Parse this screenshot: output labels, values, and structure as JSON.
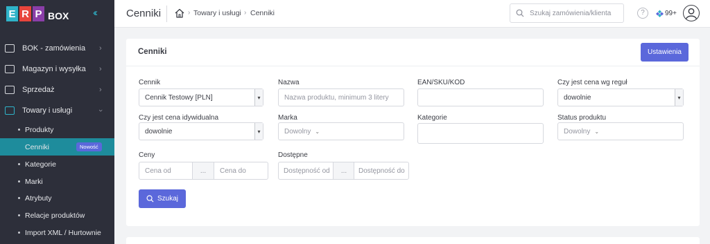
{
  "logo": {
    "letters": [
      "E",
      "R",
      "P"
    ],
    "colors": [
      "#2fb3c9",
      "#e8453c",
      "#8a3ea8"
    ],
    "suffix": "BOX"
  },
  "sidebar": {
    "items": [
      {
        "label": "BOK - zamówienia",
        "icon": "inbox-icon"
      },
      {
        "label": "Magazyn i wysyłka",
        "icon": "warehouse-icon"
      },
      {
        "label": "Sprzedaż",
        "icon": "cart-icon"
      },
      {
        "label": "Towary i usługi",
        "icon": "products-icon",
        "expanded": true
      }
    ],
    "subitems": [
      {
        "label": "Produkty"
      },
      {
        "label": "Cenniki",
        "active": true,
        "badge": "Nowość"
      },
      {
        "label": "Kategorie"
      },
      {
        "label": "Marki"
      },
      {
        "label": "Atrybuty"
      },
      {
        "label": "Relacje produktów"
      },
      {
        "label": "Import XML / Hurtownie"
      }
    ]
  },
  "header": {
    "title": "Cenniki",
    "breadcrumb": [
      "Towary i usługi",
      "Cenniki"
    ],
    "search_placeholder": "Szukaj zamówienia/klienta",
    "help": "?",
    "notifications": "99+"
  },
  "card": {
    "title": "Cenniki",
    "settings_label": "Ustawienia",
    "fields": {
      "cennik": {
        "label": "Cennik",
        "value": "Cennik Testowy [PLN]"
      },
      "nazwa": {
        "label": "Nazwa",
        "placeholder": "Nazwa produktu, minimum 3 litery"
      },
      "ean": {
        "label": "EAN/SKU/KOD",
        "value": ""
      },
      "regula": {
        "label": "Czy jest cena wg reguł",
        "value": "dowolnie"
      },
      "indywidualna": {
        "label": "Czy jest cena idywidualna",
        "value": "dowolnie"
      },
      "marka": {
        "label": "Marka",
        "value": "Dowolny"
      },
      "kategorie": {
        "label": "Kategorie",
        "value": ""
      },
      "status": {
        "label": "Status produktu",
        "value": "Dowolny"
      },
      "ceny": {
        "label": "Ceny",
        "from_placeholder": "Cena od",
        "separator": "...",
        "to_placeholder": "Cena do"
      },
      "dostepne": {
        "label": "Dostępne",
        "from_placeholder": "Dostępność od",
        "separator": "...",
        "to_placeholder": "Dostępność do"
      }
    },
    "search_label": "Szukaj"
  },
  "colors": {
    "sidebar_bg": "#2d2f3a",
    "active_item": "#1e8c9c",
    "accent": "#5b68db"
  }
}
